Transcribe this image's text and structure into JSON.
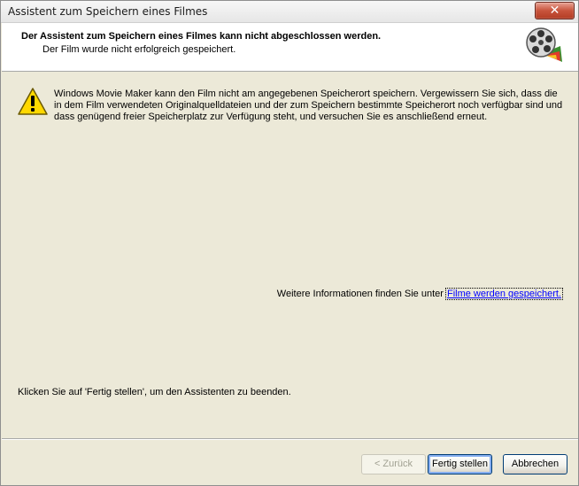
{
  "window": {
    "title": "Assistent zum Speichern eines Filmes",
    "close_label": "✕"
  },
  "header": {
    "title": "Der Assistent zum Speichern eines Filmes kann nicht abgeschlossen werden.",
    "subtitle": "Der Film wurde nicht erfolgreich gespeichert.",
    "icon": "movie-reel-icon"
  },
  "content": {
    "warning_icon": "warning-icon",
    "message": "Windows Movie Maker kann den Film nicht am angegebenen Speicherort speichern. Vergewissern Sie sich, dass die in dem Film verwendeten Originalquelldateien und der zum Speichern bestimmte Speicherort noch verfügbar sind und dass genügend freier Speicherplatz zur Verfügung steht, und versuchen Sie es anschließend erneut.",
    "more_info_text": "Weitere Informationen finden Sie unter ",
    "more_info_link": "Filme werden gespeichert.",
    "finish_note": "Klicken Sie auf 'Fertig stellen', um den Assistenten zu beenden."
  },
  "buttons": {
    "back": "< Zurück",
    "finish": "Fertig stellen",
    "cancel": "Abbrechen"
  },
  "colors": {
    "dialog_bg": "#ece9d8",
    "header_bg": "#ffffff",
    "link": "#0000ff"
  }
}
